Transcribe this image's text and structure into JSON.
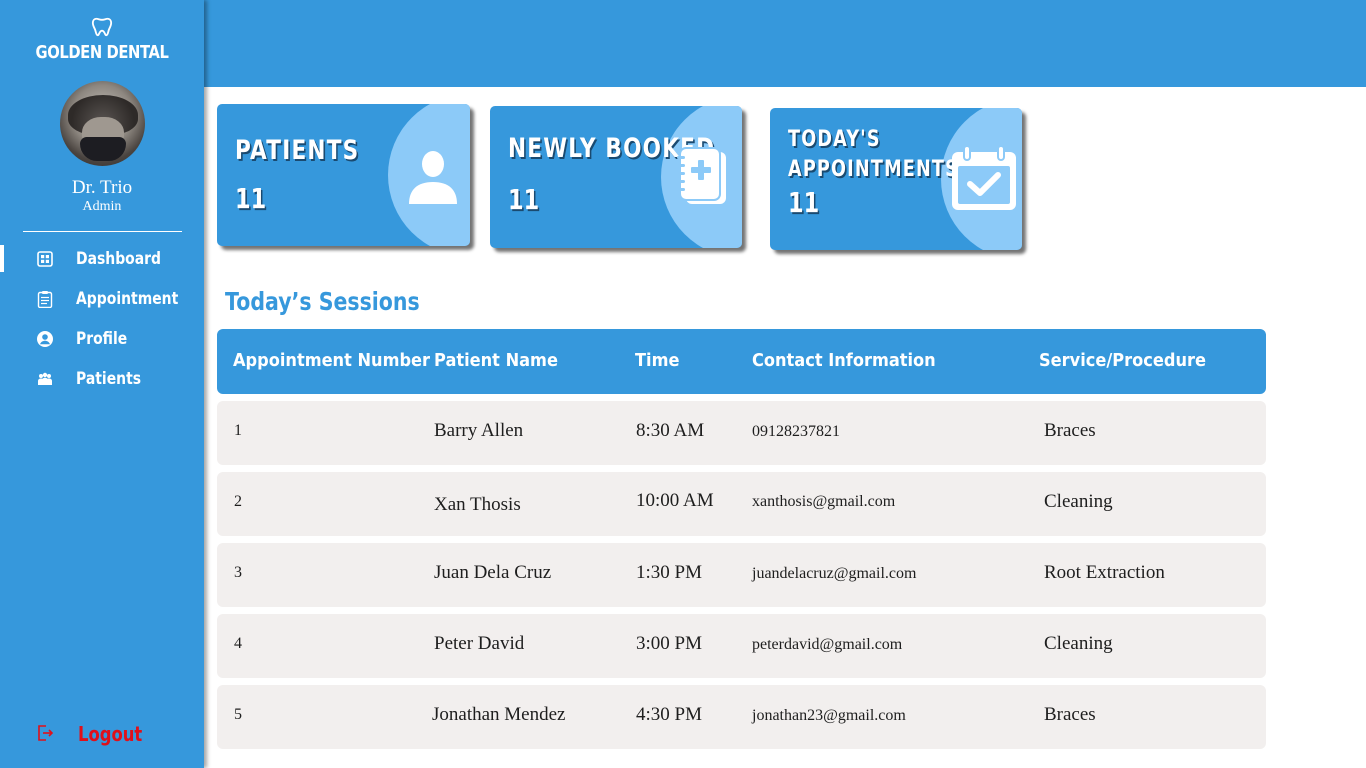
{
  "brand": {
    "name": "GOLDEN DENTAL",
    "icon": "tooth-icon"
  },
  "user": {
    "name": "Dr. Trio",
    "role": "Admin"
  },
  "nav": {
    "items": [
      {
        "label": "Dashboard",
        "icon": "dashboard-icon",
        "active": true
      },
      {
        "label": "Appointment",
        "icon": "clipboard-icon",
        "active": false
      },
      {
        "label": "Profile",
        "icon": "user-circle-icon",
        "active": false
      },
      {
        "label": "Patients",
        "icon": "group-icon",
        "active": false
      }
    ],
    "logout": {
      "label": "Logout",
      "icon": "logout-icon",
      "color": "#e0101a"
    }
  },
  "stats": [
    {
      "title": "PATIENTS",
      "value": "11",
      "icon": "person-icon"
    },
    {
      "title": "NEWLY BOOKED",
      "value": "11",
      "icon": "booking-notebook-icon"
    },
    {
      "title_line1": "TODAY'S",
      "title_line2": "APPOINTMENTS",
      "value": "11",
      "icon": "calendar-check-icon"
    }
  ],
  "sessions": {
    "title": "Today’s Sessions",
    "columns": [
      "Appointment Number",
      "Patient Name",
      "Time",
      "Contact Information",
      "Service/Procedure"
    ],
    "rows": [
      [
        "1",
        "Barry Allen",
        "8:30 AM",
        "09128237821",
        "Braces"
      ],
      [
        "2",
        "Xan Thosis",
        "10:00 AM",
        "xanthosis@gmail.com",
        "Cleaning"
      ],
      [
        "3",
        "Juan Dela Cruz",
        "1:30 PM",
        "juandelacruz@gmail.com",
        "Root Extraction"
      ],
      [
        "4",
        "Peter David",
        "3:00 PM",
        "peterdavid@gmail.com",
        "Cleaning"
      ],
      [
        "5",
        "Jonathan Mendez",
        "4:30 PM",
        "jonathan23@gmail.com",
        "Braces"
      ]
    ]
  },
  "colors": {
    "primary": "#3698dc",
    "card_circle": "#8ccaf8",
    "row_bg": "#f2efee",
    "logout": "#e0101a"
  }
}
